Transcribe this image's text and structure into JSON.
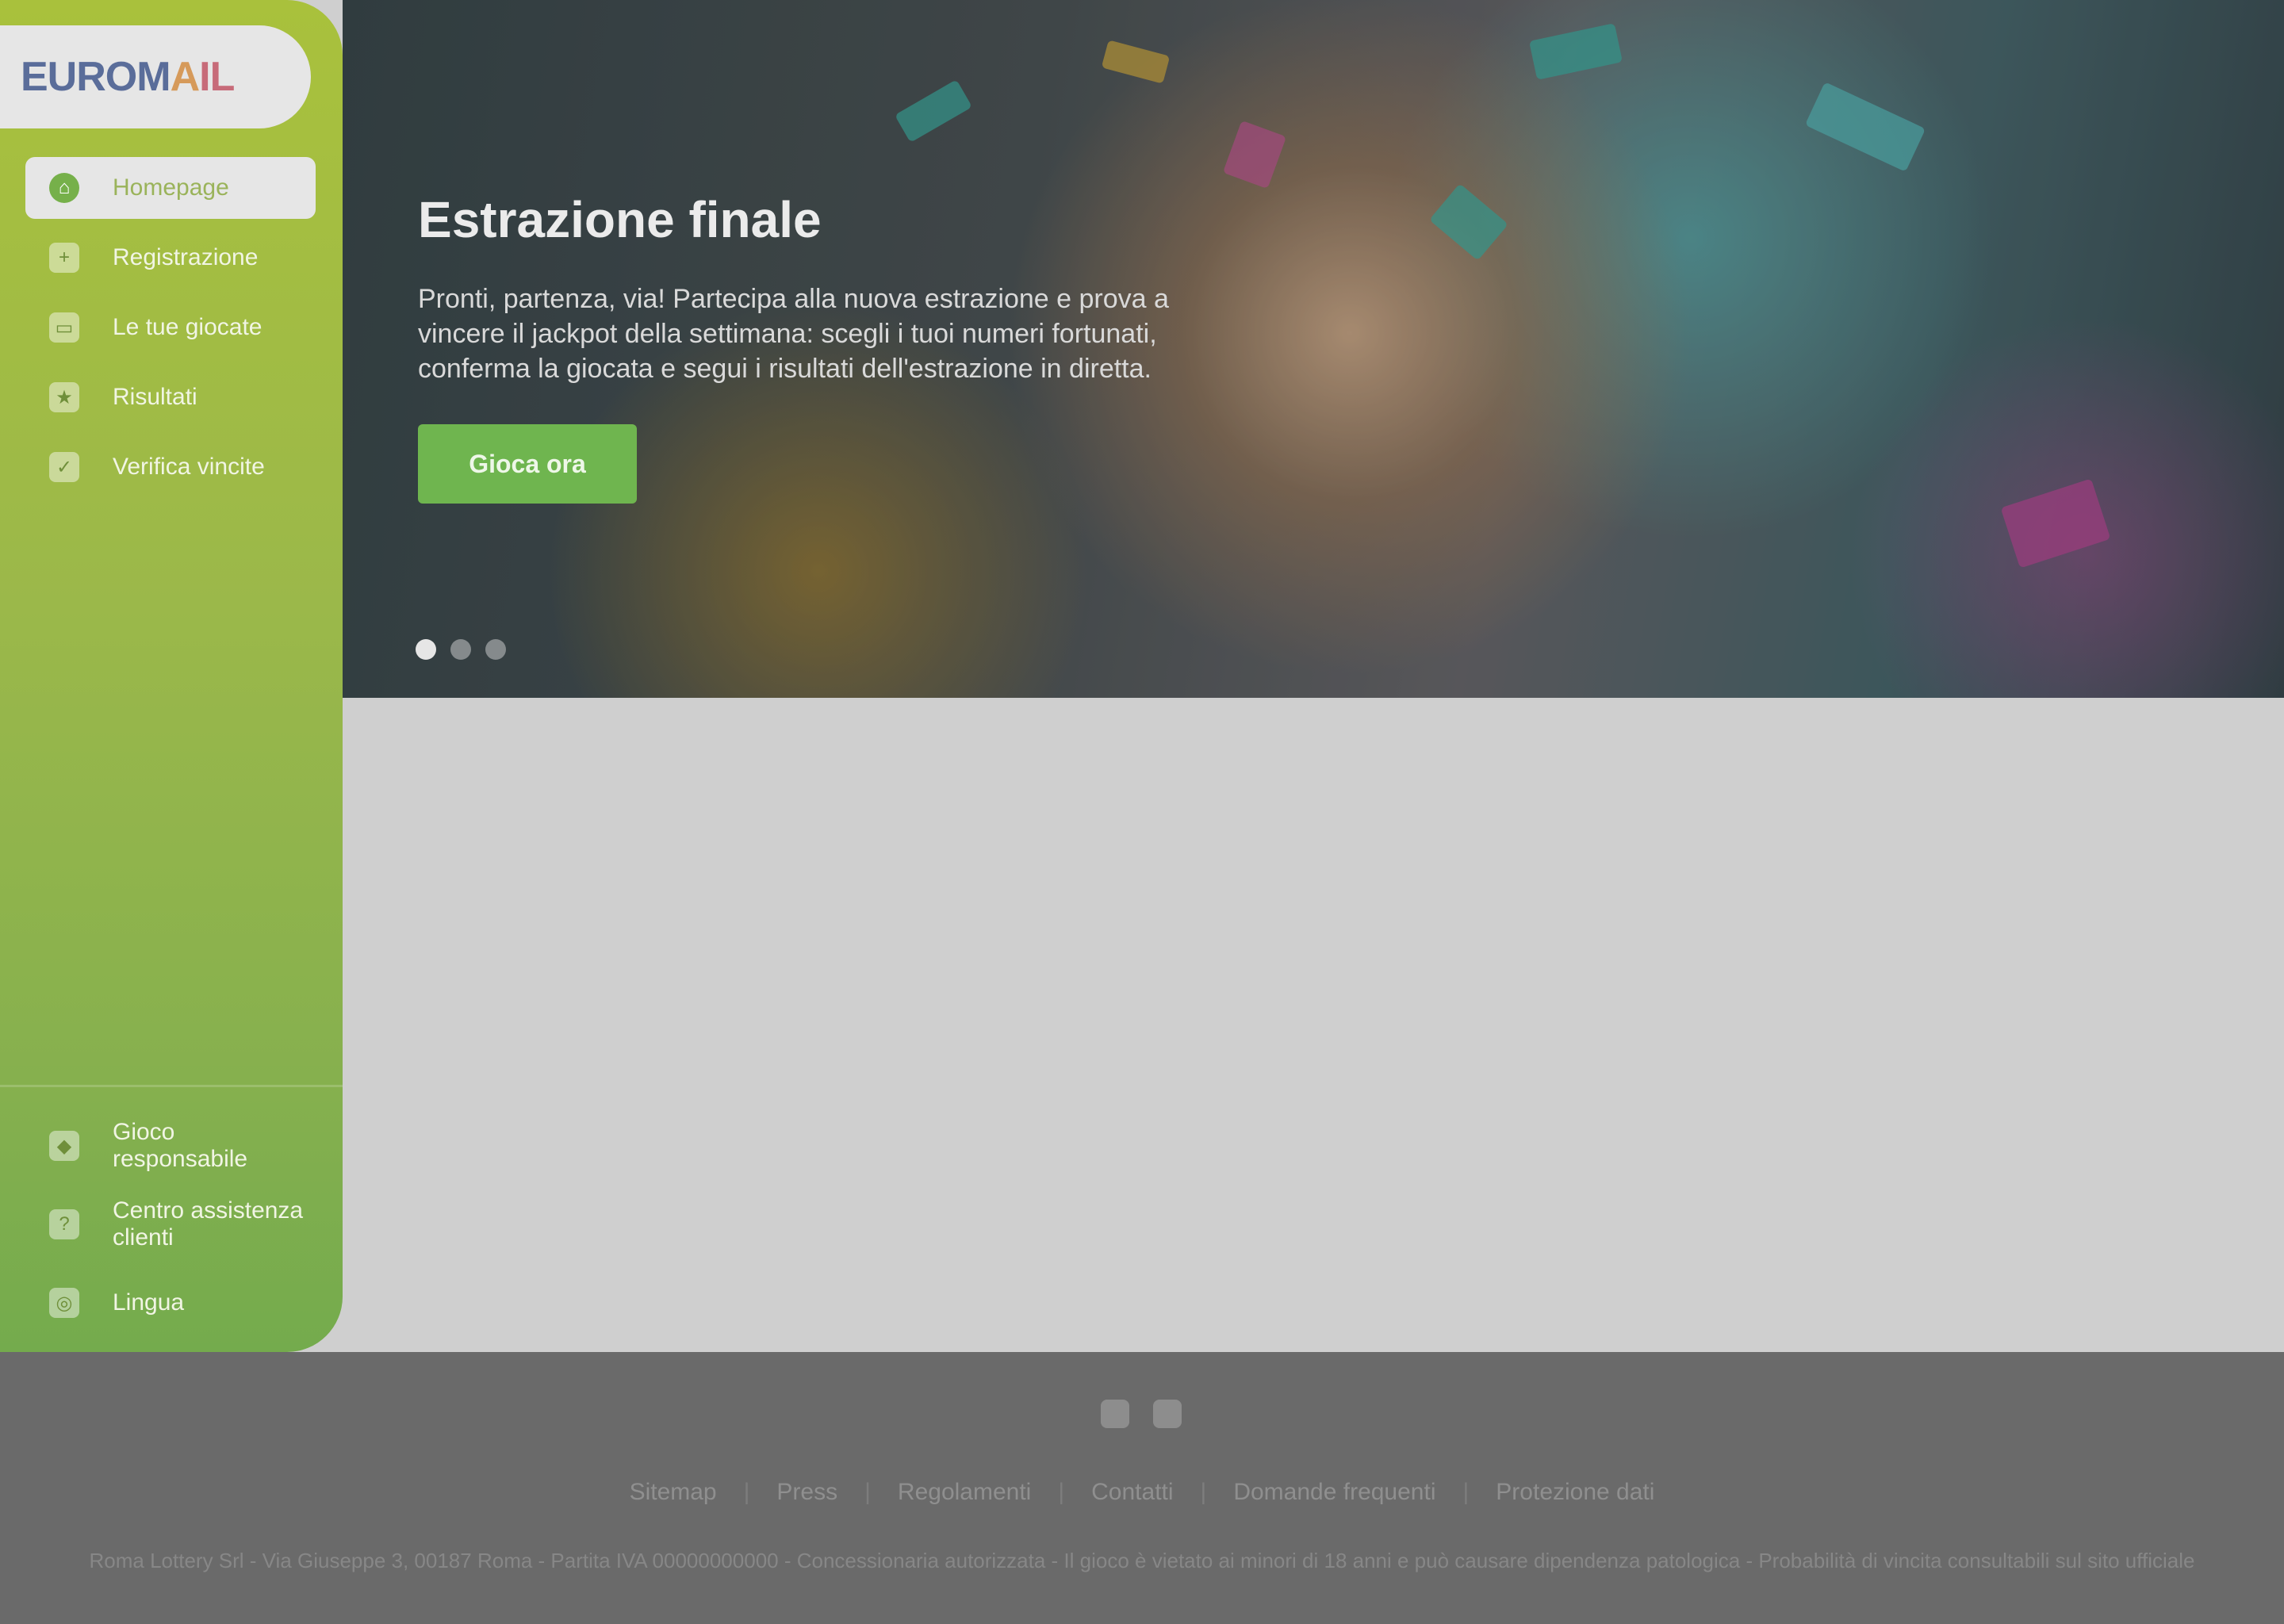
{
  "brand": {
    "logo_text": [
      "EUROM",
      "A",
      "IL"
    ]
  },
  "sidebar": {
    "items": [
      {
        "label": "Homepage",
        "icon": "home-icon",
        "active": true
      },
      {
        "label": "Registrazione",
        "icon": "user-plus-icon"
      },
      {
        "label": "Le tue giocate",
        "icon": "ticket-icon"
      },
      {
        "label": "Risultati",
        "icon": "trophy-icon"
      },
      {
        "label": "Verifica vincite",
        "icon": "check-icon"
      }
    ],
    "bottom": [
      {
        "label": "Gioco responsabile",
        "icon": "shield-icon"
      },
      {
        "label": "Centro assistenza clienti",
        "icon": "help-icon"
      },
      {
        "label": "Lingua",
        "icon": "globe-icon"
      }
    ],
    "colors": {
      "top": "#a9c13c",
      "bottom": "#74ab4d",
      "active_bg": "#e6e6e6"
    }
  },
  "hero": {
    "title": "Estrazione finale",
    "text": "Pronti, partenza, via! Partecipa alla nuova estrazione e prova a vincere il jackpot della settimana: scegli i tuoi numeri fortunati, conferma la giocata e segui i risultati dell'estrazione in diretta.",
    "button": "Gioca ora",
    "slides": 3,
    "active_slide": 1
  },
  "footer": {
    "social": [
      "facebook-icon",
      "instagram-icon"
    ],
    "links": [
      "Sitemap",
      "Press",
      "Regolamenti",
      "Contatti",
      "Domande frequenti",
      "Protezione dati"
    ],
    "legal": "Roma Lottery Srl - Via Giuseppe 3, 00187 Roma - Partita IVA 00000000000 - Concessionaria autorizzata - Il gioco è vietato ai minori di 18 anni e può causare dipendenza patologica - Probabilità di vincita consultabili sul sito ufficiale"
  }
}
